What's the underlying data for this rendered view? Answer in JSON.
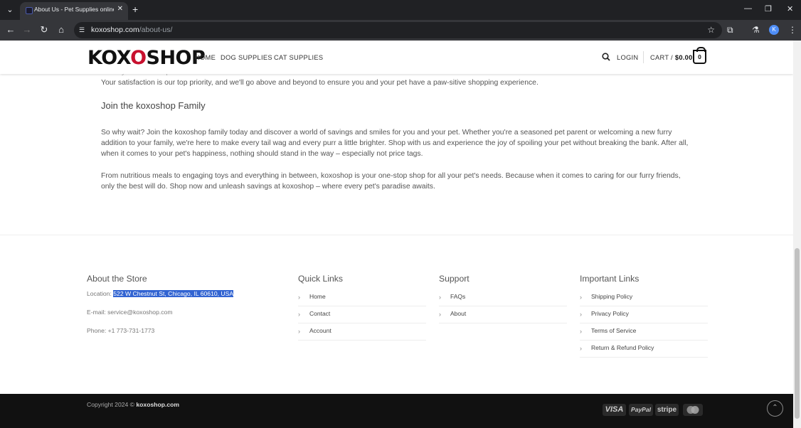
{
  "browser": {
    "tab_title": "About Us - Pet Supplies online",
    "new_tab": "+",
    "url_host": "koxoshop.com",
    "url_path": "/about-us/",
    "avatar_letter": "K"
  },
  "header": {
    "logo_prefix": "KOX",
    "logo_mid": "O",
    "logo_suffix": "SHOP",
    "menu": [
      "HOME",
      "DOG SUPPLIES",
      "CAT SUPPLIES"
    ],
    "login": "LOGIN",
    "cart_label": "CART /",
    "cart_total": "$0.00",
    "cart_count": "0"
  },
  "content": {
    "ghost_line": "customer. So rest assured we're here to assist you every step of the way, whether you have a question about a product, need help placing an order, or simply want to share stories about your beloved pet.",
    "p1": "Your satisfaction is our top priority, and we'll go above and beyond to ensure you and your pet have a paw-sitive shopping experience.",
    "join_heading": "Join the koxoshop Family",
    "p2": "So why wait? Join the koxoshop family today and discover a world of savings and smiles for you and your pet. Whether you're a seasoned pet parent or welcoming a new furry addition to your family, we're here to make every tail wag and every purr a little brighter. Shop with us and experience the joy of spoiling your pet without breaking the bank. After all, when it comes to your pet's happiness, nothing should stand in the way – especially not price tags.",
    "p3": "From nutritious meals to engaging toys and everything in between, koxoshop is your one-stop shop for all your pet's needs. Because when it comes to caring for our furry friends, only the best will do. Shop now and unleash savings at koxoshop – where every pet's paradise awaits."
  },
  "footer": {
    "about": {
      "title": "About the Store",
      "location_label": "Location: ",
      "location_value": "522 W Chestnut St, Chicago, IL 60610, USA",
      "email": "E-mail: service@koxoshop.com",
      "phone": "Phone: +1 773-731-1773"
    },
    "quick_links": {
      "title": "Quick Links",
      "items": [
        "Home",
        "Contact",
        "Account"
      ]
    },
    "support": {
      "title": "Support",
      "items": [
        "FAQs",
        "About"
      ]
    },
    "important": {
      "title": "Important Links",
      "items": [
        "Shipping Policy",
        "Privacy Policy",
        "Terms of Service",
        "Return & Refund Policy"
      ]
    },
    "copyright_prefix": "Copyright 2024 © ",
    "copyright_site": "koxoshop.com",
    "payments": [
      "VISA",
      "PayPal",
      "stripe"
    ]
  }
}
